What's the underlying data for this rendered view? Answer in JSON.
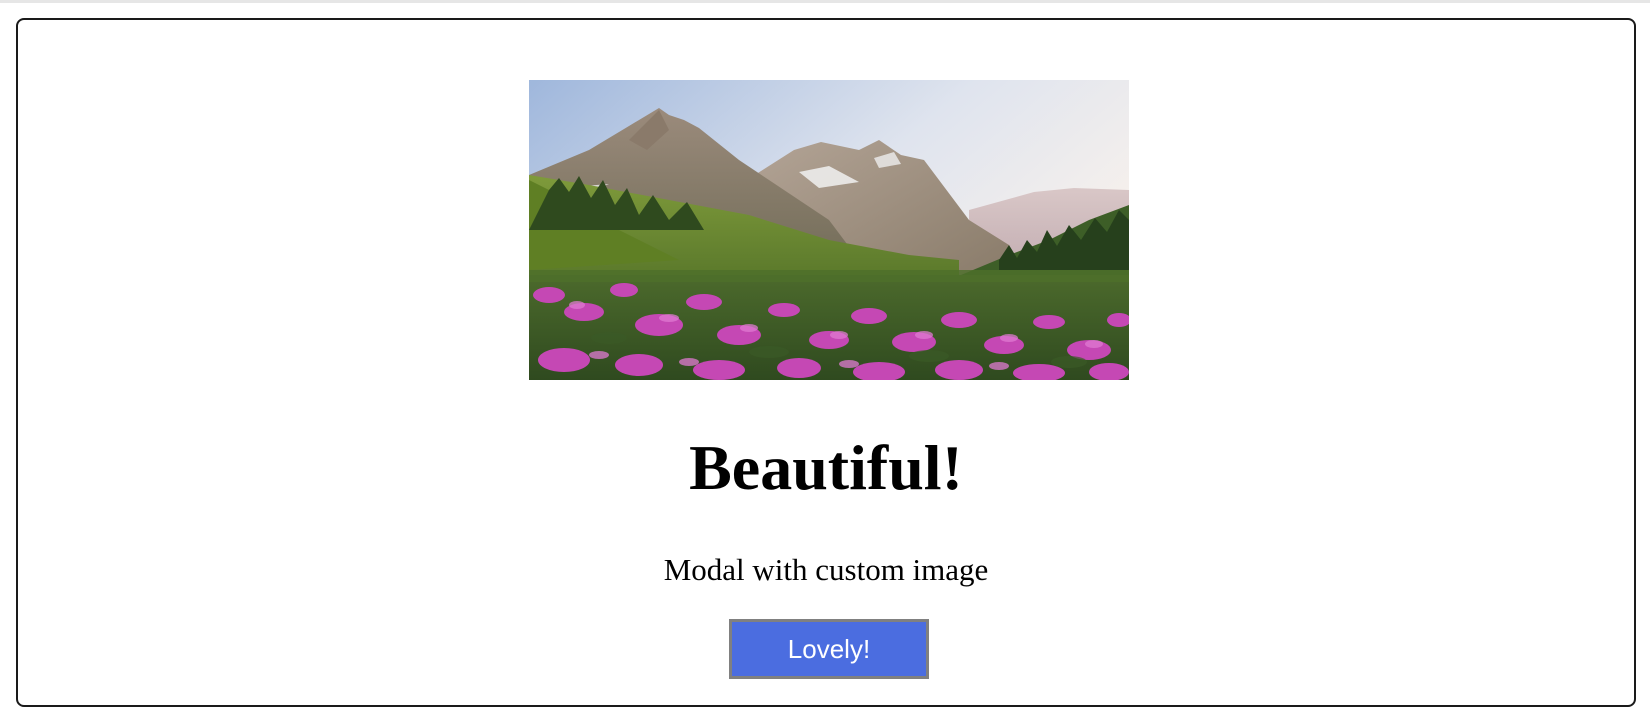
{
  "modal": {
    "image_alt": "Mountain landscape with a meadow of purple wildflowers",
    "title": "Beautiful!",
    "text": "Modal with custom image",
    "confirm_label": "Lovely!"
  },
  "colors": {
    "confirm_button_bg": "#4b6de0",
    "confirm_button_border": "#808080",
    "modal_border": "#1a1a1a"
  }
}
